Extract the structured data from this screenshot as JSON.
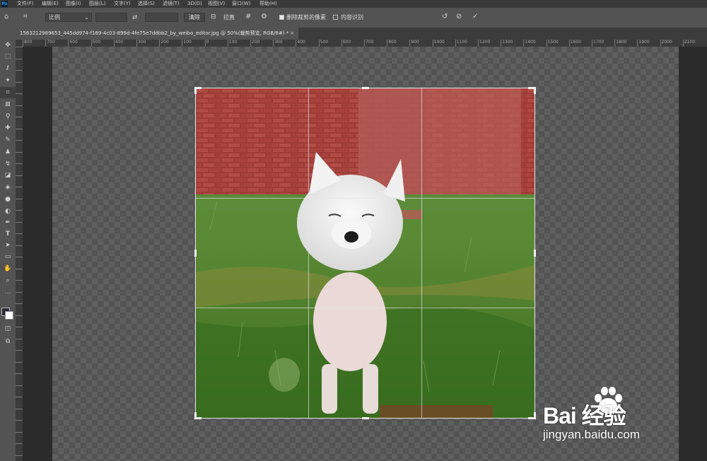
{
  "menu": {
    "items": [
      "文件(F)",
      "编辑(E)",
      "图像(I)",
      "图层(L)",
      "文字(Y)",
      "选择(S)",
      "滤镜(T)",
      "3D(D)",
      "视图(V)",
      "窗口(W)",
      "帮助(H)"
    ]
  },
  "options": {
    "ratio_select": "比例",
    "swap_icon": "swap-arrows-icon",
    "clear_label": "清除",
    "straighten_label": "拉直",
    "delete_cropped_label": "删除裁剪的像素",
    "delete_cropped_checked": true,
    "content_aware_label": "内容识别",
    "content_aware_checked": false
  },
  "document": {
    "tab_title": "1563212989653_445dd974-f169-4c03-899d-4fe75e7ddbb2_by_weibo_editor.jpg @ 50%(裁剪预览, RGB/8#) *",
    "close_glyph": "×"
  },
  "ruler": {
    "h_labels": [
      "800",
      "700",
      "600",
      "500",
      "400",
      "300",
      "200",
      "100",
      "0",
      "100",
      "200",
      "300",
      "400",
      "500",
      "600",
      "700",
      "800",
      "900",
      "1000",
      "1100",
      "1200",
      "1300",
      "1400",
      "1500",
      "1600",
      "1700",
      "1800",
      "1900",
      "2000",
      "2100"
    ]
  },
  "watermark": {
    "brand": "Bai  经验",
    "url": "jingyan.baidu.com"
  },
  "colors": {
    "accent": "#31a8ff",
    "panel": "#535353",
    "canvas_bg": "#2b2b2b"
  }
}
